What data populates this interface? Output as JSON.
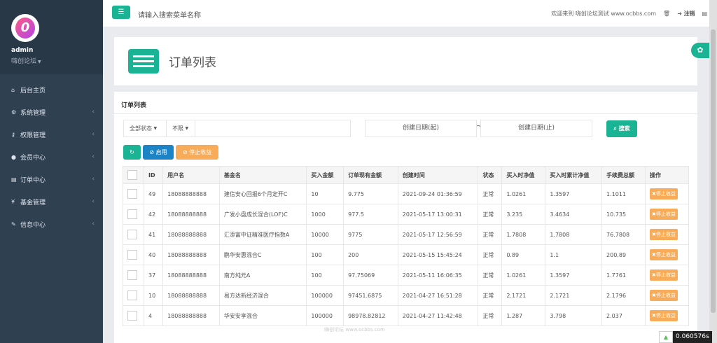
{
  "sidebar": {
    "username": "admin",
    "role": "嗨创论坛",
    "items": [
      {
        "label": "后台主页",
        "icon": "home-icon",
        "glyph": "⌂",
        "arrow": ""
      },
      {
        "label": "系统管理",
        "icon": "cogs-icon",
        "glyph": "⚙",
        "arrow": "‹"
      },
      {
        "label": "权限管理",
        "icon": "key-icon",
        "glyph": "⚷",
        "arrow": "‹"
      },
      {
        "label": "会员中心",
        "icon": "user-icon",
        "glyph": "●",
        "arrow": "‹"
      },
      {
        "label": "订单中心",
        "icon": "list-icon",
        "glyph": "▤",
        "arrow": "‹"
      },
      {
        "label": "基金管理",
        "icon": "yen-icon",
        "glyph": "¥",
        "arrow": "‹"
      },
      {
        "label": "信息中心",
        "icon": "wrench-icon",
        "glyph": "✎",
        "arrow": "‹"
      }
    ]
  },
  "topbar": {
    "search_placeholder": "请输入搜索菜单名称",
    "welcome": "欢迎来到 嗨创论坛测试 www.ocbbs.com",
    "logout": "注销"
  },
  "page": {
    "title": "订单列表",
    "panel_title": "订单列表"
  },
  "filters": {
    "status": "全部状态",
    "unlimited": "不限",
    "start_date": "创建日期(起)",
    "tilde": "~",
    "end_date": "创建日期(止)",
    "search": "搜索"
  },
  "actions": {
    "enable": "启用",
    "stop": "停止收益",
    "row_stop": "✖停止收益"
  },
  "table": {
    "headers": [
      "",
      "ID",
      "用户名",
      "基金名",
      "买入金额",
      "订单现有金额",
      "创建时间",
      "状态",
      "买入时净值",
      "买入时累计净值",
      "手续费总额",
      "操作"
    ],
    "rows": [
      [
        "49",
        "18088888888",
        "建信安心回报6个月定开C",
        "10",
        "9.775",
        "2021-09-24 01:36:59",
        "正常",
        "1.0261",
        "1.3597",
        "1.1011"
      ],
      [
        "42",
        "18088888888",
        "广发小盘成长混合(LOF)C",
        "1000",
        "977.5",
        "2021-05-17 13:00:31",
        "正常",
        "3.235",
        "3.4634",
        "10.735"
      ],
      [
        "41",
        "18088888888",
        "汇添富中证精准医疗指数A",
        "10000",
        "9775",
        "2021-05-17 12:56:59",
        "正常",
        "1.7808",
        "1.7808",
        "76.7808"
      ],
      [
        "40",
        "18088888888",
        "鹏华安惠混合C",
        "100",
        "200",
        "2021-05-15 15:45:24",
        "正常",
        "0.89",
        "1.1",
        "200.89"
      ],
      [
        "37",
        "18088888888",
        "南方纯元A",
        "100",
        "97.75069",
        "2021-05-11 16:06:35",
        "正常",
        "1.0261",
        "1.3597",
        "1.7761"
      ],
      [
        "10",
        "18088888888",
        "易方达新经济混合",
        "100000",
        "97451.6875",
        "2021-04-27 16:51:28",
        "正常",
        "2.1721",
        "2.1721",
        "2.1796"
      ],
      [
        "4",
        "18088888888",
        "华安安享混合",
        "100000",
        "98978.82812",
        "2021-04-27 11:42:48",
        "正常",
        "1.287",
        "3.798",
        "2.037"
      ]
    ]
  },
  "footer": {
    "watermark": "嗨创论坛 www.ocbbs.com",
    "timer": "0.060576s"
  }
}
